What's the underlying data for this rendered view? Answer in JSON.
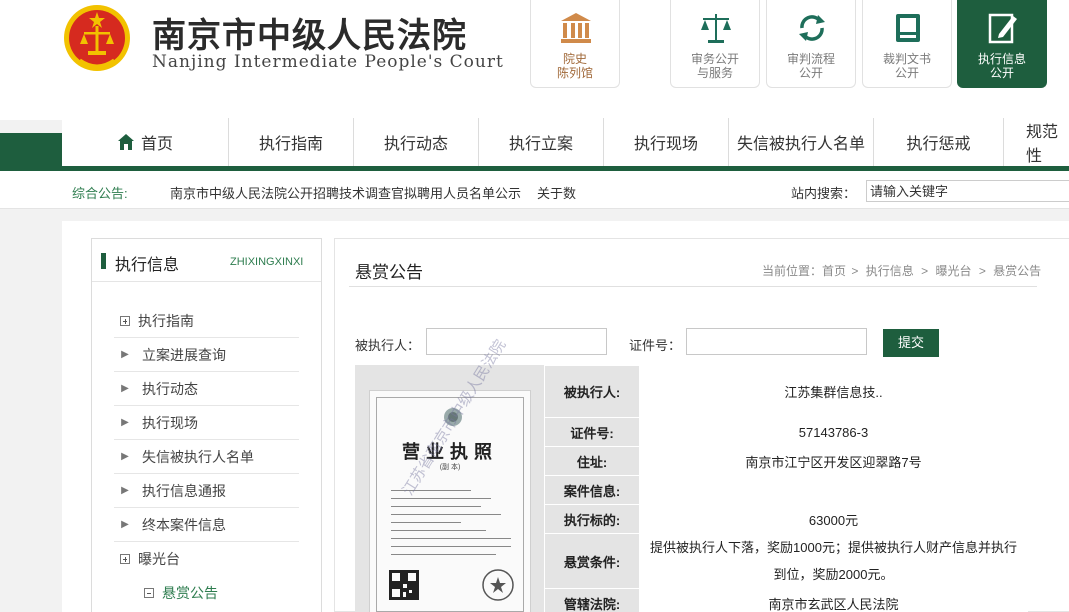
{
  "header": {
    "court_name_cn": "南京市中级人民法院",
    "court_name_en": "Nanjing Intermediate People's Court",
    "top_buttons": [
      {
        "label_line1": "院史",
        "label_line2": "陈列馆",
        "icon": "pillar-building-icon"
      },
      {
        "label_line1": "审务公开",
        "label_line2": "与服务",
        "icon": "scales-icon"
      },
      {
        "label_line1": "审判流程",
        "label_line2": "公开",
        "icon": "cycle-arrows-icon"
      },
      {
        "label_line1": "裁判文书",
        "label_line2": "公开",
        "icon": "document-book-icon"
      },
      {
        "label_line1": "执行信息",
        "label_line2": "公开",
        "icon": "edit-pen-icon",
        "active": true
      }
    ]
  },
  "nav": {
    "items": [
      "首页",
      "执行指南",
      "执行动态",
      "执行立案",
      "执行现场",
      "失信被执行人名单",
      "执行惩戒",
      "规范性"
    ]
  },
  "notice": {
    "label": "综合公告:",
    "items": [
      "南京市中级人民法院公开招聘技术调查官拟聘用人员名单公示",
      "关于数"
    ],
    "search_label": "站内搜索：",
    "search_placeholder": "请输入关键字"
  },
  "sidebar": {
    "title": "执行信息",
    "title_en": "ZHIXINGXINXI",
    "items": [
      {
        "label": "执行指南",
        "marker": "plus"
      },
      {
        "label": "立案进展查询",
        "marker": "arrow"
      },
      {
        "label": "执行动态",
        "marker": "arrow"
      },
      {
        "label": "执行现场",
        "marker": "arrow"
      },
      {
        "label": "失信被执行人名单",
        "marker": "arrow"
      },
      {
        "label": "执行信息通报",
        "marker": "arrow"
      },
      {
        "label": "终本案件信息",
        "marker": "arrow"
      },
      {
        "label": "曝光台",
        "marker": "plus"
      },
      {
        "label": "悬赏公告",
        "marker": "minus"
      }
    ]
  },
  "main": {
    "title": "悬赏公告",
    "breadcrumb": {
      "prefix": "当前位置：",
      "items": [
        "首页",
        "执行信息",
        "曝光台",
        "悬赏公告"
      ],
      "separator": ">"
    },
    "form": {
      "name_label": "被执行人：",
      "id_label": "证件号：",
      "submit_label": "提交"
    },
    "license_image": {
      "title": "营业执照",
      "subtitle": "(副 本)",
      "watermark": "江苏省南京市中级人民法院"
    },
    "record": {
      "rows": [
        {
          "key": "被执行人:",
          "value": "江苏集群信息技.."
        },
        {
          "key": "证件号:",
          "value": "57143786-3"
        },
        {
          "key": "住址:",
          "value": "南京市江宁区开发区迎翠路7号"
        },
        {
          "key": "案件信息:",
          "value": ""
        },
        {
          "key": "执行标的:",
          "value": "63000元"
        },
        {
          "key": "悬赏条件:",
          "value": "提供被执行人下落，奖励1000元；提供被执行人财产信息并执行到位，奖励2000元。"
        },
        {
          "key": "管辖法院:",
          "value": "南京市玄武区人民法院"
        }
      ]
    }
  },
  "colors": {
    "brand_green": "#1e5e3e",
    "link_green": "#2e7d4f",
    "emblem_red": "#d62a1f",
    "emblem_gold": "#f2c200",
    "museum_brown": "#a06838"
  }
}
